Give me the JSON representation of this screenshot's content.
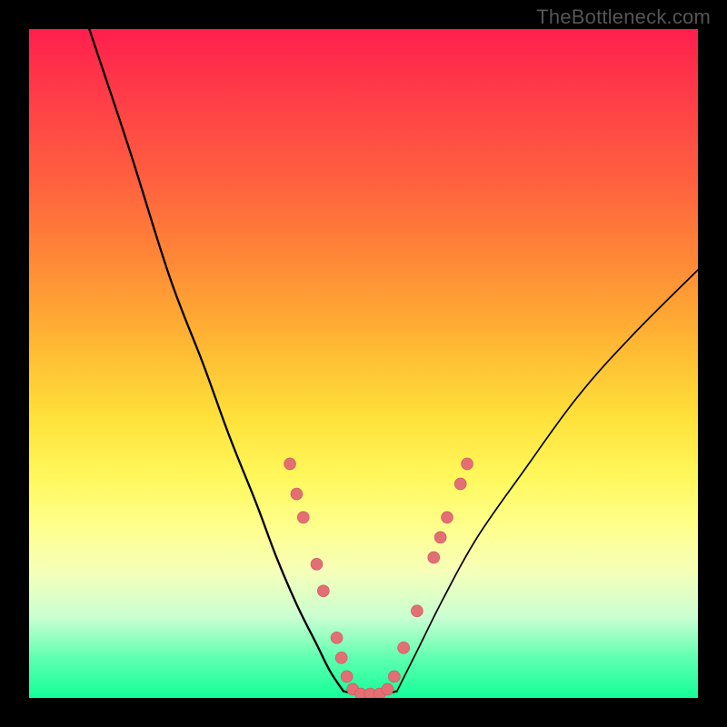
{
  "attribution": "TheBottleneck.com",
  "colors": {
    "frame": "#000000",
    "curve": "#000000",
    "marker_fill": "#e36f75",
    "marker_stroke": "#c95760",
    "gradient_stops": [
      "#ff1f4d",
      "#ff3a48",
      "#ff5e3f",
      "#ff8a36",
      "#ffb733",
      "#ffe13a",
      "#fff85c",
      "#ffff8a",
      "#f6ffb8",
      "#c9ffd2",
      "#5fffb0",
      "#13ff97"
    ]
  },
  "chart_data": {
    "type": "line",
    "title": "",
    "xlabel": "",
    "ylabel": "",
    "xlim": [
      0,
      100
    ],
    "ylim": [
      0,
      100
    ],
    "grid": false,
    "series": [
      {
        "name": "left-curve",
        "x": [
          9,
          15,
          21,
          26,
          30,
          34,
          37,
          40,
          43,
          45,
          47
        ],
        "y": [
          100,
          82,
          63,
          50,
          39,
          29,
          21,
          14,
          8,
          4,
          1
        ]
      },
      {
        "name": "basin-flat",
        "x": [
          47,
          49,
          51,
          53,
          55
        ],
        "y": [
          1,
          0.6,
          0.6,
          0.6,
          1
        ]
      },
      {
        "name": "right-curve",
        "x": [
          55,
          58,
          62,
          67,
          74,
          82,
          90,
          100
        ],
        "y": [
          1,
          7,
          15,
          24,
          34,
          45,
          54,
          64
        ]
      }
    ],
    "markers": [
      {
        "x": 39,
        "y": 35
      },
      {
        "x": 40,
        "y": 30.5
      },
      {
        "x": 41,
        "y": 27
      },
      {
        "x": 43,
        "y": 20
      },
      {
        "x": 44,
        "y": 16
      },
      {
        "x": 46,
        "y": 9
      },
      {
        "x": 46.7,
        "y": 6
      },
      {
        "x": 47.5,
        "y": 3.2
      },
      {
        "x": 48.4,
        "y": 1.3
      },
      {
        "x": 49.6,
        "y": 0.6
      },
      {
        "x": 51.0,
        "y": 0.6
      },
      {
        "x": 52.4,
        "y": 0.6
      },
      {
        "x": 53.6,
        "y": 1.3
      },
      {
        "x": 54.6,
        "y": 3.2
      },
      {
        "x": 56,
        "y": 7.5
      },
      {
        "x": 58,
        "y": 13
      },
      {
        "x": 60.5,
        "y": 21
      },
      {
        "x": 61.5,
        "y": 24
      },
      {
        "x": 62.5,
        "y": 27
      },
      {
        "x": 64.5,
        "y": 32
      },
      {
        "x": 65.5,
        "y": 35
      }
    ]
  }
}
